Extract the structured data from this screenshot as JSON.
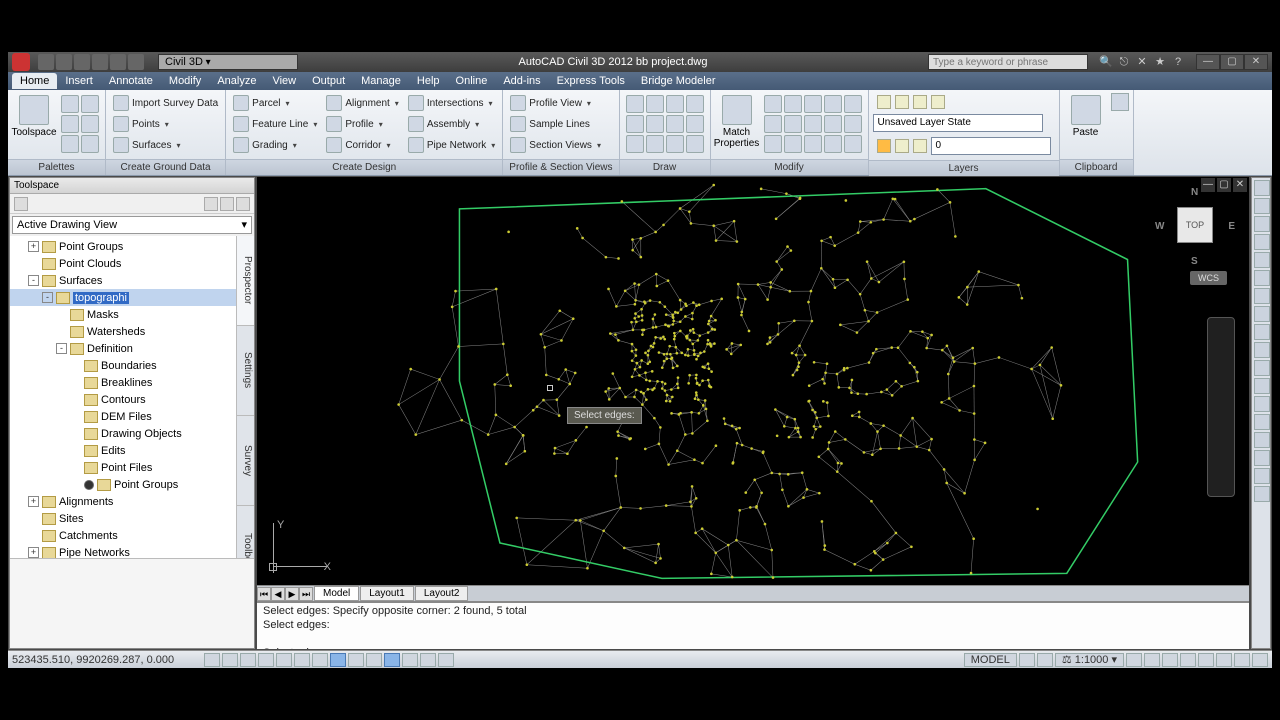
{
  "titlebar": {
    "workspace": "Civil 3D",
    "title": "AutoCAD Civil 3D 2012    bb project.dwg",
    "search_placeholder": "Type a keyword or phrase"
  },
  "menus": [
    "Home",
    "Insert",
    "Annotate",
    "Modify",
    "Analyze",
    "View",
    "Output",
    "Manage",
    "Help",
    "Online",
    "Add-ins",
    "Express Tools",
    "Bridge Modeler"
  ],
  "ribbon": {
    "palettes": {
      "big": "Toolspace",
      "title": "Palettes"
    },
    "ground": {
      "items": [
        "Import Survey Data",
        "Points",
        "Surfaces"
      ],
      "title": "Create Ground Data"
    },
    "design": {
      "col1": [
        "Parcel",
        "Feature Line",
        "Grading"
      ],
      "col2": [
        "Alignment",
        "Profile",
        "Corridor"
      ],
      "col3": [
        "Intersections",
        "Assembly",
        "Pipe Network"
      ],
      "title": "Create Design"
    },
    "profile": {
      "items": [
        "Profile View",
        "Sample Lines",
        "Section Views"
      ],
      "title": "Profile & Section Views"
    },
    "draw": {
      "title": "Draw"
    },
    "match": {
      "big": "Match Properties",
      "title": "Modify"
    },
    "layers": {
      "state": "Unsaved Layer State",
      "current": "0",
      "title": "Layers"
    },
    "paste": {
      "big": "Paste",
      "title": "Clipboard"
    }
  },
  "toolspace": {
    "title": "Toolspace",
    "dropdown": "Active Drawing View",
    "vtabs": [
      "Prospector",
      "Settings",
      "Survey",
      "Toolbox"
    ],
    "tree": [
      {
        "d": 1,
        "exp": "+",
        "lbl": "Point Groups"
      },
      {
        "d": 1,
        "exp": "",
        "lbl": "Point Clouds"
      },
      {
        "d": 1,
        "exp": "-",
        "lbl": "Surfaces"
      },
      {
        "d": 2,
        "exp": "-",
        "lbl": "topographi",
        "sel": true
      },
      {
        "d": 3,
        "exp": "",
        "lbl": "Masks"
      },
      {
        "d": 3,
        "exp": "",
        "lbl": "Watersheds"
      },
      {
        "d": 3,
        "exp": "-",
        "lbl": "Definition"
      },
      {
        "d": 4,
        "exp": "",
        "lbl": "Boundaries"
      },
      {
        "d": 4,
        "exp": "",
        "lbl": "Breaklines"
      },
      {
        "d": 4,
        "exp": "",
        "lbl": "Contours"
      },
      {
        "d": 4,
        "exp": "",
        "lbl": "DEM Files"
      },
      {
        "d": 4,
        "exp": "",
        "lbl": "Drawing Objects"
      },
      {
        "d": 4,
        "exp": "",
        "lbl": "Edits"
      },
      {
        "d": 4,
        "exp": "",
        "lbl": "Point Files"
      },
      {
        "d": 4,
        "exp": "",
        "lbl": "Point Groups",
        "rad": true
      },
      {
        "d": 1,
        "exp": "+",
        "lbl": "Alignments"
      },
      {
        "d": 1,
        "exp": "",
        "lbl": "Sites"
      },
      {
        "d": 1,
        "exp": "",
        "lbl": "Catchments"
      },
      {
        "d": 1,
        "exp": "+",
        "lbl": "Pipe Networks"
      }
    ]
  },
  "viewport": {
    "tooltip": "Select edges:",
    "cube": "TOP",
    "wcs": "WCS",
    "tabs": [
      "Model",
      "Layout1",
      "Layout2"
    ],
    "cmd": [
      "Select edges: Specify opposite corner: 2 found, 5 total",
      "Select edges:",
      "",
      "Select edges:"
    ]
  },
  "status": {
    "coords": "523435.510, 9920269.287, 0.000",
    "model": "MODEL",
    "scale": "1:1000"
  }
}
